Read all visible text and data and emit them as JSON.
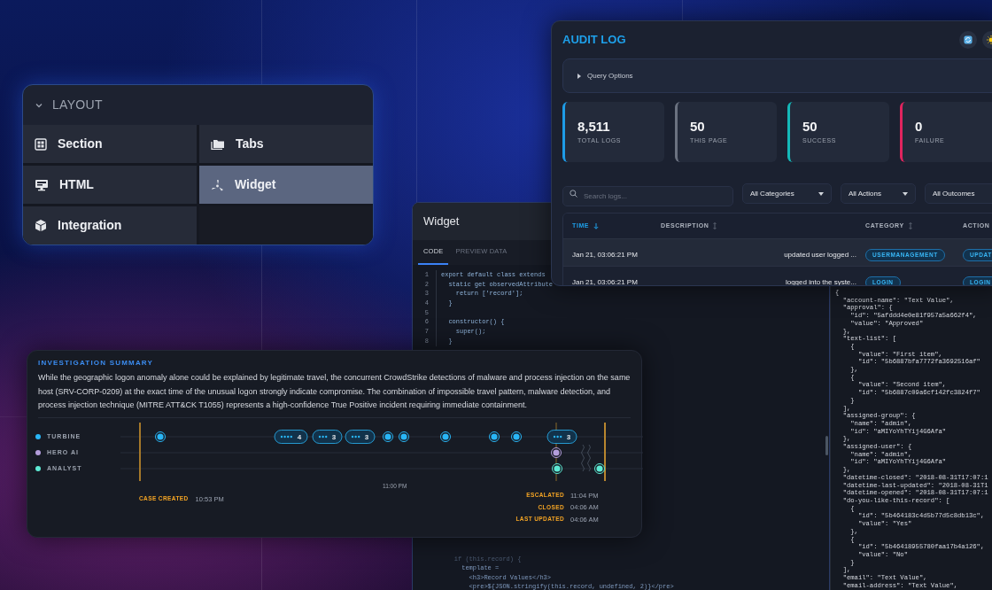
{
  "layout_panel": {
    "title": "LAYOUT",
    "expanded": true,
    "items": [
      {
        "label": "Section",
        "selected": false
      },
      {
        "label": "Tabs",
        "selected": false
      },
      {
        "label": "HTML",
        "selected": false
      },
      {
        "label": "Widget",
        "selected": true
      },
      {
        "label": "Integration",
        "selected": false
      }
    ]
  },
  "widget_editor": {
    "title": "Widget",
    "tabs": [
      {
        "label": "CODE",
        "selected": true
      },
      {
        "label": "PREVIEW DATA",
        "selected": false
      }
    ],
    "code_lines": [
      {
        "number": "1",
        "text": "export default class extends"
      },
      {
        "number": "2",
        "text": "  static get observedAttribute"
      },
      {
        "number": "3",
        "text": "    return ['record'];"
      },
      {
        "number": "4",
        "text": "  }"
      },
      {
        "number": "5"
      },
      {
        "number": "6",
        "text": "  constructor() {"
      },
      {
        "number": "7",
        "text": "    super();"
      },
      {
        "number": "8",
        "text": "  }"
      }
    ],
    "code_lines_bottom": [
      {
        "text": "    if (this.record) {"
      },
      {
        "text": "      template ="
      },
      {
        "text": "        <h3>Record Values</h3>"
      },
      {
        "text": "        <pre>${JSON.stringify(this.record, undefined, 2)}</pre>"
      }
    ],
    "preview_lines": [
      "{",
      "  \"account-name\": \"Text Value\",",
      "  \"approval\": {",
      "    \"id\": \"5afddd4e0e81f957a5a662f4\",",
      "    \"value\": \"Approved\"",
      "  },",
      "  \"text-list\": [",
      "    {",
      "      \"value\": \"First item\",",
      "      \"id\": \"5b6887bfa7772fa3692516af\"",
      "    },",
      "    {",
      "      \"value\": \"Second item\",",
      "      \"id\": \"5b6887c09a6cf142fc3824f7\"",
      "    }",
      "  ],",
      "  \"assigned-group\": {",
      "    \"name\": \"admin\",",
      "    \"id\": \"aMIYoYhTYij4G6Afa\"",
      "  },",
      "  \"assigned-user\": {",
      "    \"name\": \"admin\",",
      "    \"id\": \"aMIYoYhTYij4G6Afa\"",
      "  },",
      "  \"datetime-closed\": \"2018-08-31T17:07:1",
      "  \"datetime-last-updated\": \"2018-08-31T1",
      "  \"datetime-opened\": \"2018-08-31T17:07:1",
      "  \"do-you-like-this-record\": [",
      "    {",
      "      \"id\": \"5b464183c4d5b77d5c8db13c\",",
      "      \"value\": \"Yes\"",
      "    },",
      "    {",
      "      \"id\": \"5b46418955780faa17b4a126\",",
      "      \"value\": \"No\"",
      "    }",
      "  ],",
      "  \"email\": \"Text Value\",",
      "  \"email-address\": \"Text Value\","
    ]
  },
  "audit_log": {
    "title": "AUDIT LOG",
    "query_options": {
      "label": "Query Options",
      "expanded": false
    },
    "stats": [
      {
        "value": "8,511",
        "label": "TOTAL LOGS",
        "color": "#1e9be6"
      },
      {
        "value": "50",
        "label": "THIS PAGE",
        "color": "#6b7280"
      },
      {
        "value": "50",
        "label": "SUCCESS",
        "color": "#14b8b8"
      },
      {
        "value": "0",
        "label": "FAILURE",
        "color": "#e0245e"
      }
    ],
    "search": {
      "placeholder": "Search logs..."
    },
    "filters": [
      "All Categories",
      "All Actions",
      "All Outcomes"
    ],
    "columns": [
      {
        "label": "TIME",
        "sorted": true
      },
      {
        "label": "DESCRIPTION",
        "sorted": false
      },
      {
        "label": "CATEGORY",
        "sorted": false
      },
      {
        "label": "ACTION",
        "sorted": false
      }
    ],
    "rows": [
      {
        "time": "Jan 21, 03:06:21 PM",
        "description": "updated user logged ...",
        "category": "USERMANAGEMENT",
        "action": "UPDAT"
      },
      {
        "time": "Jan 21, 03:06:21 PM",
        "description": "logged into the syste...",
        "category": "LOGIN",
        "action": "LOGIN"
      }
    ]
  },
  "investigation_summary": {
    "title": "INVESTIGATION SUMMARY",
    "text": "While the geographic logon anomaly alone could be explained by legitimate travel, the concurrent CrowdStrike detections of malware and process injection on the same host (SRV-CORP-0209) at the exact time of the unusual logon strongly indicate compromise. The combination of impossible travel pattern, malware detection, and process injection technique (MITRE ATT&CK T1055) represents a high-confidence True Positive incident requiring immediate containment.",
    "timeline": {
      "lanes": [
        {
          "name": "TURBINE",
          "color": "#29b6f6"
        },
        {
          "name": "HERO AI",
          "color": "#b39ddb"
        },
        {
          "name": "ANALYST",
          "color": "#5eead4"
        }
      ],
      "clusters": [
        {
          "count": "4"
        },
        {
          "count": "3"
        },
        {
          "count": "3"
        },
        {
          "count": "3"
        }
      ],
      "axis_label": "11:00 PM",
      "milestones": [
        {
          "label": "CASE CREATED",
          "time": "10:53 PM"
        },
        {
          "label": "ESCALATED",
          "time": "11:04 PM"
        },
        {
          "label": "CLOSED",
          "time": "04:06 AM"
        },
        {
          "label": "LAST UPDATED",
          "time": "04:06 AM"
        }
      ]
    }
  }
}
